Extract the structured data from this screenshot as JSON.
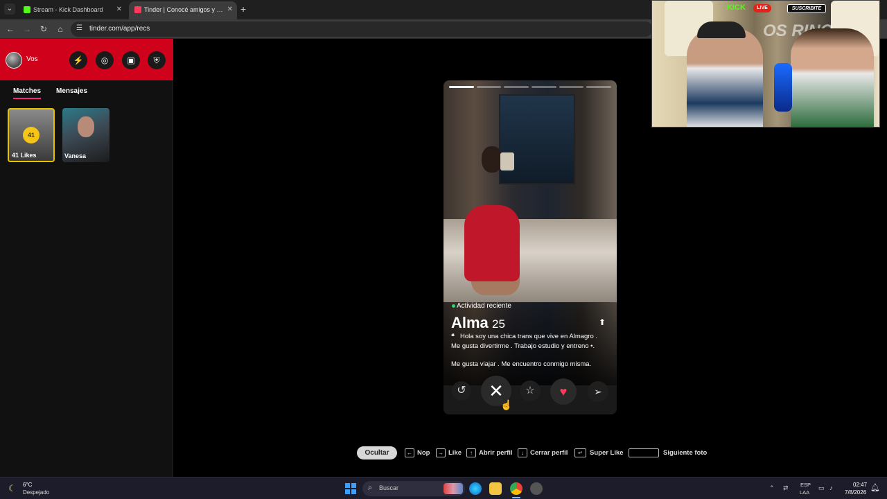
{
  "browser": {
    "tabs": [
      {
        "title": "Stream - Kick Dashboard",
        "favicon_color": "#53fc18",
        "active": false
      },
      {
        "title": "Tinder | Conocé amigos y gente nueva",
        "favicon_color": "#fd3a5c",
        "active": true
      }
    ],
    "url": "tinder.com/app/recs",
    "icons": {
      "back": "back-arrow-icon",
      "forward": "forward-arrow-icon",
      "reload": "reload-icon",
      "home": "home-icon",
      "site_settings": "tune-icon"
    }
  },
  "sidebar": {
    "user_name": "Vos",
    "header_color": "#d0021b",
    "header_buttons": [
      "lightning-icon",
      "compass-icon",
      "briefcase-icon",
      "shield-icon"
    ],
    "tabs": [
      {
        "label": "Matches",
        "active": true
      },
      {
        "label": "Mensajes",
        "active": false
      }
    ],
    "likes_card": {
      "count": "41",
      "label": "41 Likes"
    },
    "matches": [
      {
        "name": "Vanesa"
      }
    ]
  },
  "profile": {
    "activity": "Actividad reciente",
    "name": "Alma",
    "age": "25",
    "bio_line1": "Hola soy una chica trans que vive en Almagro .",
    "bio_line2": "Me gusta divertirme . Trabajo estudio y entreno •.",
    "bio_line3": "Me gusta viajar . Me encuentro conmigo misma.",
    "photo_count": 6,
    "current_photo": 1
  },
  "actions": {
    "rewind": "↺",
    "nope": "✕",
    "super_like": "☆",
    "like": "♥",
    "boost": "➢"
  },
  "shortcuts": {
    "hide": "Ocultar",
    "items": [
      {
        "key": "←",
        "label": "Nop"
      },
      {
        "key": "→",
        "label": "Like"
      },
      {
        "key": "↑",
        "label": "Abrir perfil"
      },
      {
        "key": "↓",
        "label": "Cerrar perfil"
      },
      {
        "key": "↵",
        "label": "Super Like"
      },
      {
        "key": "",
        "label": "Siguiente foto"
      }
    ]
  },
  "webcam": {
    "kick": "KICK",
    "live": "LIVE",
    "subscribe": "SUSCRIBITE",
    "logo": "OS RINO"
  },
  "taskbar": {
    "weather_temp": "6°C",
    "weather_desc": "Despejado",
    "search": "Buscar",
    "lang1": "ESP",
    "lang2": "LAA",
    "time": "02:47",
    "date": "7/8/2026"
  }
}
